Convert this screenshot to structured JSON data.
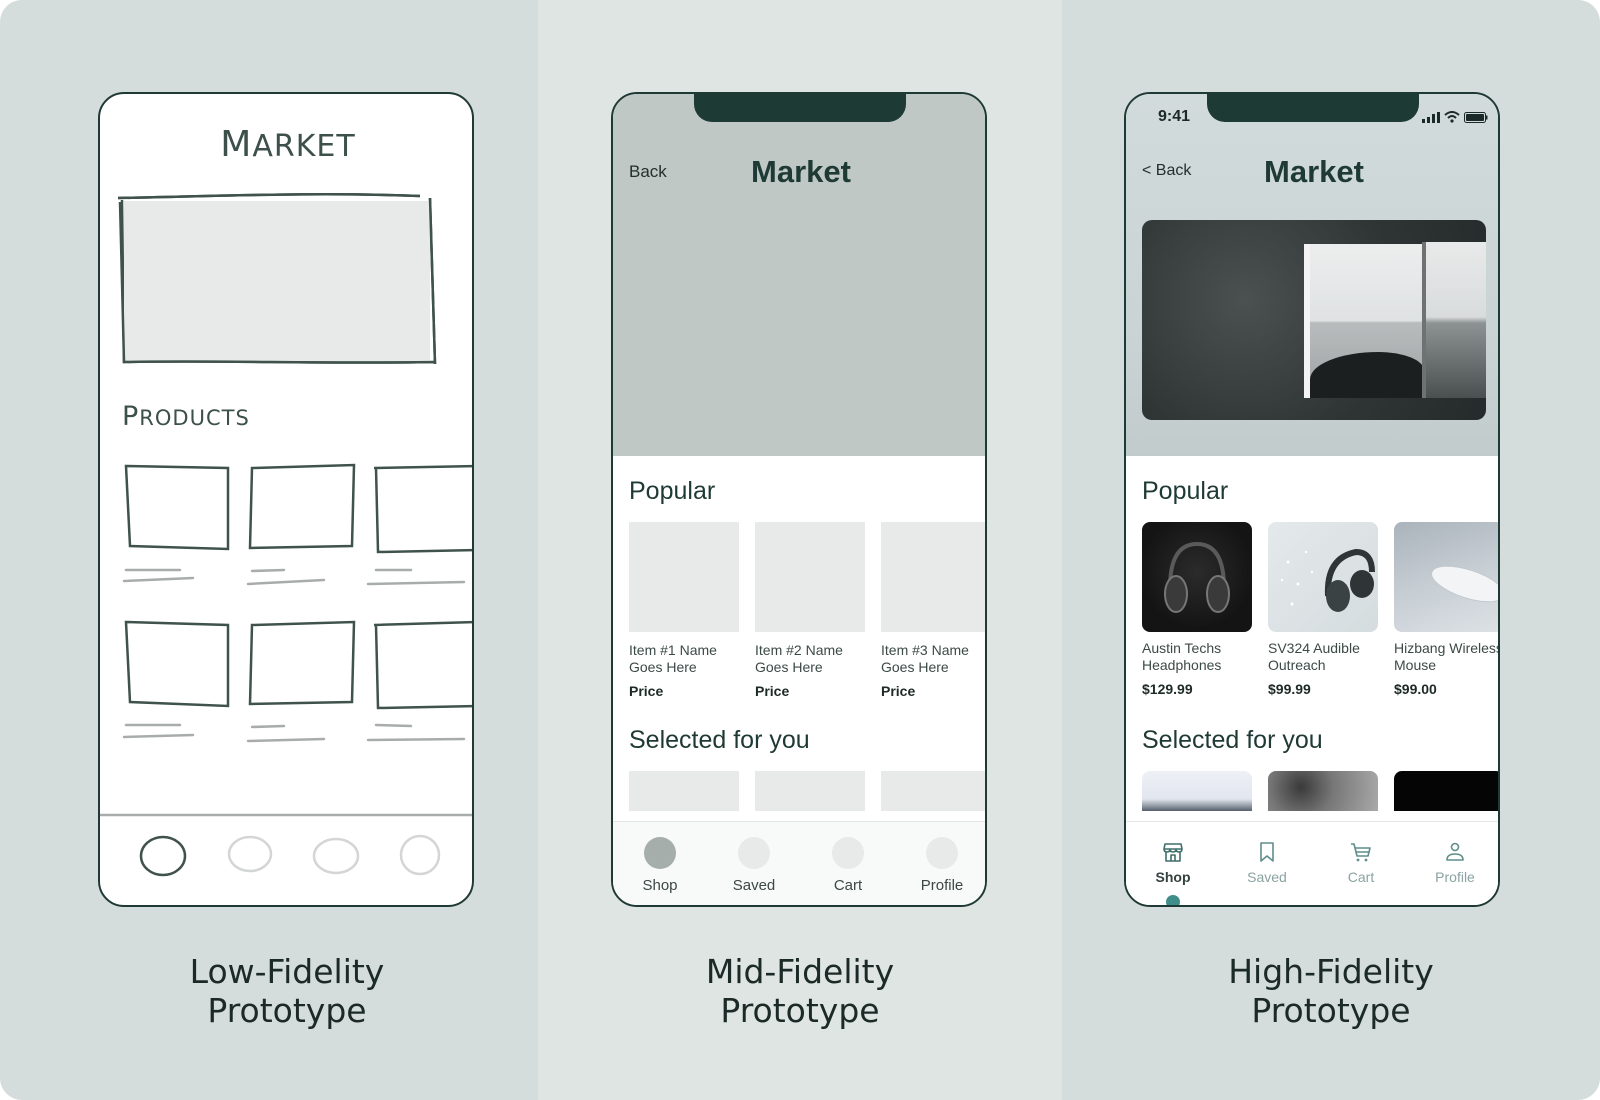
{
  "captions": {
    "low": [
      "Low-Fidelity",
      "Prototype"
    ],
    "mid": [
      "Mid-Fidelity",
      "Prototype"
    ],
    "high": [
      "High-Fidelity",
      "Prototype"
    ]
  },
  "low_fidelity": {
    "title_initial": "M",
    "title_rest": "ARKET",
    "section_initial": "P",
    "section_rest": "RODUCTS",
    "nav_icons": [
      "sketch-circle-active",
      "sketch-circle",
      "sketch-circle",
      "sketch-circle"
    ]
  },
  "mid_fidelity": {
    "back_label": "Back",
    "title": "Market",
    "popular_title": "Popular",
    "popular_items": [
      {
        "name": "Item #1 Name Goes Here",
        "price": "Price"
      },
      {
        "name": "Item #2 Name Goes Here",
        "price": "Price"
      },
      {
        "name": "Item #3 Name Goes Here",
        "price": "Price"
      }
    ],
    "selected_title": "Selected for you",
    "tabs": [
      {
        "label": "Shop",
        "active": true
      },
      {
        "label": "Saved",
        "active": false
      },
      {
        "label": "Cart",
        "active": false
      },
      {
        "label": "Profile",
        "active": false
      }
    ]
  },
  "high_fidelity": {
    "status_time": "9:41",
    "back_label": "< Back",
    "title": "Market",
    "hero_image": "open-book-landscape-photo",
    "popular_title": "Popular",
    "popular_items": [
      {
        "name": "Austin Techs Headphones",
        "price": "$129.99",
        "image": "black-headphones-photo"
      },
      {
        "name": "SV324 Audible Outreach",
        "price": "$99.99",
        "image": "grey-headphones-photo"
      },
      {
        "name": "Hizbang Wireless Mouse",
        "price": "$99.00",
        "image": "white-mouse-photo"
      }
    ],
    "selected_title": "Selected for you",
    "tabs": [
      {
        "label": "Shop",
        "icon": "store-icon",
        "active": true
      },
      {
        "label": "Saved",
        "icon": "bookmark-icon",
        "active": false
      },
      {
        "label": "Cart",
        "icon": "cart-icon",
        "active": false
      },
      {
        "label": "Profile",
        "icon": "user-icon",
        "active": false
      }
    ],
    "accent_color": "#3f8e8c"
  }
}
